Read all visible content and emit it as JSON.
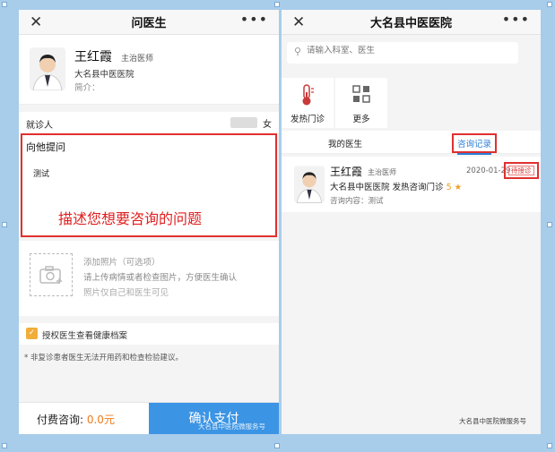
{
  "left": {
    "title": "问医生",
    "doctor": {
      "name": "王红霞",
      "title": "主治医师",
      "hospital": "大名县中医医院",
      "intro": "简介："
    },
    "patient_label": "就诊人",
    "patient_sex": "女",
    "question_title": "向他提问",
    "question_value": "测试",
    "question_hint": "描述您想要咨询的问题",
    "photo_title": "添加照片（可选项）",
    "photo_desc": "请上传病情或者检查图片，方便医生确认",
    "photo_note": "照片仅自己和医生可见",
    "consent": "授权医生查看健康档案",
    "notice": "* 非复诊患者医生无法开用药和检查检验建议。",
    "fee_label": "付费咨询: ",
    "fee_amount": "0.0元",
    "pay_button": "确认支付",
    "watermark": "大名县中医院微服务号"
  },
  "right": {
    "title": "大名县中医医院",
    "search_placeholder": "请输入科室、医生",
    "services": [
      {
        "label": "发热门诊",
        "icon": "thermometer-icon"
      },
      {
        "label": "更多",
        "icon": "grid-icon"
      }
    ],
    "tabs": [
      "我的医生",
      "咨询记录"
    ],
    "record": {
      "name": "王红霞",
      "title": "主治医师",
      "date": "2020-01-29",
      "status": "待接诊",
      "hospital": "大名县中医医院 发热咨询门诊",
      "score": "5",
      "consult": "咨询内容：测试"
    },
    "watermark": "大名县中医院微服务号"
  },
  "colors": {
    "accent_blue": "#3c94e4",
    "highlight_red": "#e03030",
    "fee_orange": "#f07a1a",
    "check_orange": "#f0ad3a"
  }
}
